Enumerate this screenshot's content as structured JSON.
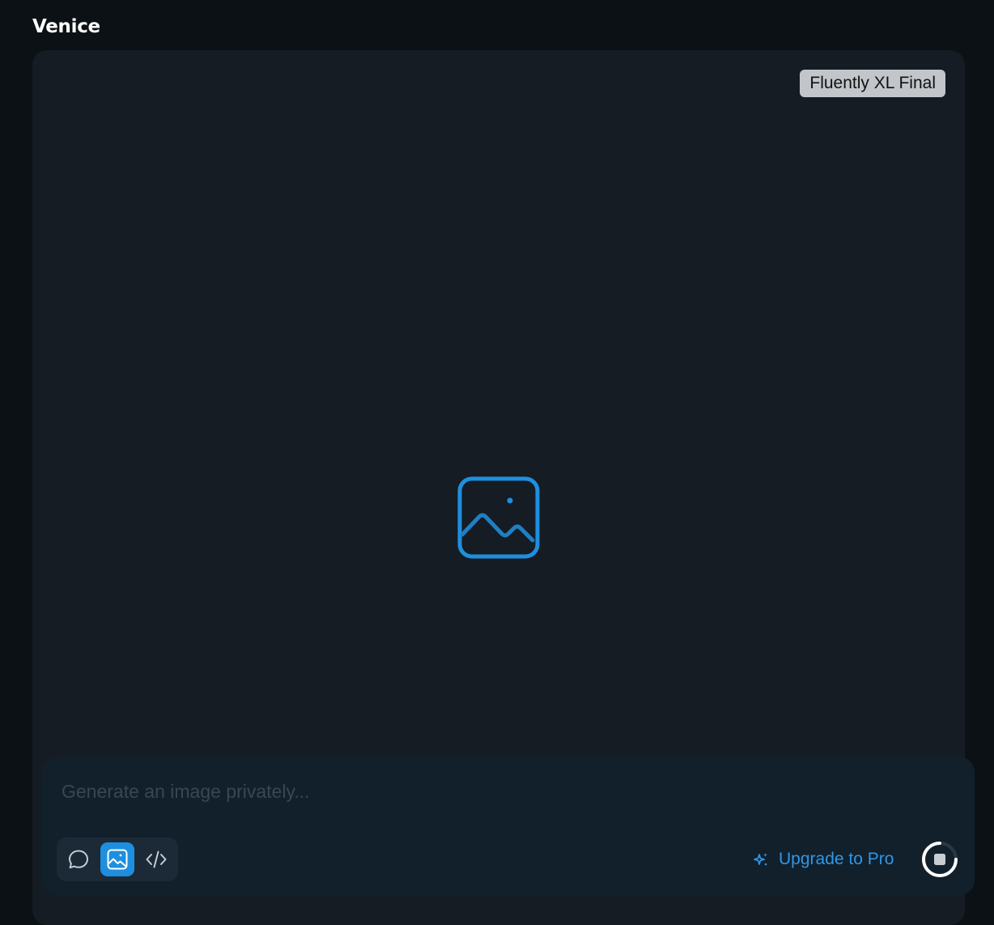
{
  "app": {
    "title": "Venice"
  },
  "canvas": {
    "model_badge": "Fluently XL Final",
    "placeholder_icon": "image-icon"
  },
  "prompt": {
    "value": "",
    "placeholder": "Generate an image privately..."
  },
  "modes": [
    {
      "name": "chat",
      "icon": "chat-bubble-icon",
      "active": false
    },
    {
      "name": "image",
      "icon": "image-icon",
      "active": true
    },
    {
      "name": "code",
      "icon": "code-icon",
      "active": false
    }
  ],
  "upgrade": {
    "label": "Upgrade to Pro",
    "icon": "sparkles-icon"
  },
  "stop": {
    "icon": "stop-icon"
  },
  "colors": {
    "background": "#0b1114",
    "panel": "#151c23",
    "prompt_bar": "#12202b",
    "accent": "#1e8fe0",
    "link": "#2f97e8",
    "badge": "#c2c6ca"
  }
}
